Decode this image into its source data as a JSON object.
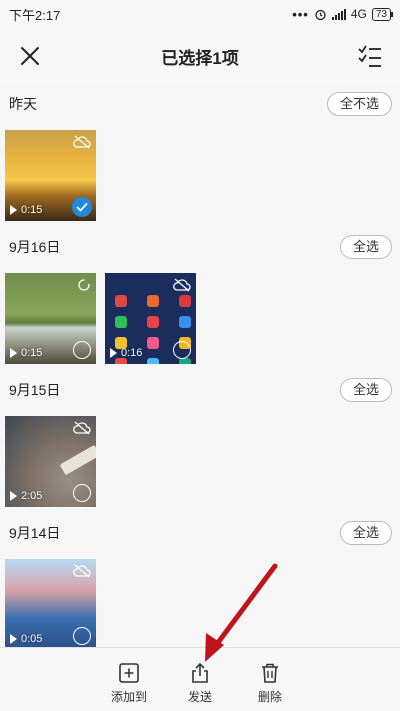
{
  "status_bar": {
    "time": "下午2:17",
    "network": "4G",
    "battery": "73"
  },
  "header": {
    "title": "已选择1项"
  },
  "sections": [
    {
      "date": "昨天",
      "action": "全不选",
      "items": [
        {
          "duration": "0:15",
          "selected": true,
          "cloud_off": true
        }
      ]
    },
    {
      "date": "9月16日",
      "action": "全选",
      "items": [
        {
          "duration": "0:15",
          "selected": false,
          "cloud_off": false
        },
        {
          "duration": "0:16",
          "selected": false,
          "cloud_off": true
        }
      ]
    },
    {
      "date": "9月15日",
      "action": "全选",
      "items": [
        {
          "duration": "2:05",
          "selected": false,
          "cloud_off": true
        }
      ]
    },
    {
      "date": "9月14日",
      "action": "全选",
      "items": [
        {
          "duration": "0:05",
          "selected": false,
          "cloud_off": true
        }
      ]
    }
  ],
  "bottom_bar": {
    "add_to": "添加到",
    "send": "发送",
    "delete": "删除"
  },
  "colors": {
    "accent": "#1f8ad8",
    "annotation_arrow": "#c0141c"
  },
  "icons": [
    "close-icon",
    "checklist-icon",
    "cloud-off-icon",
    "play-icon",
    "check-icon",
    "add-square-icon",
    "share-icon",
    "trash-icon"
  ]
}
